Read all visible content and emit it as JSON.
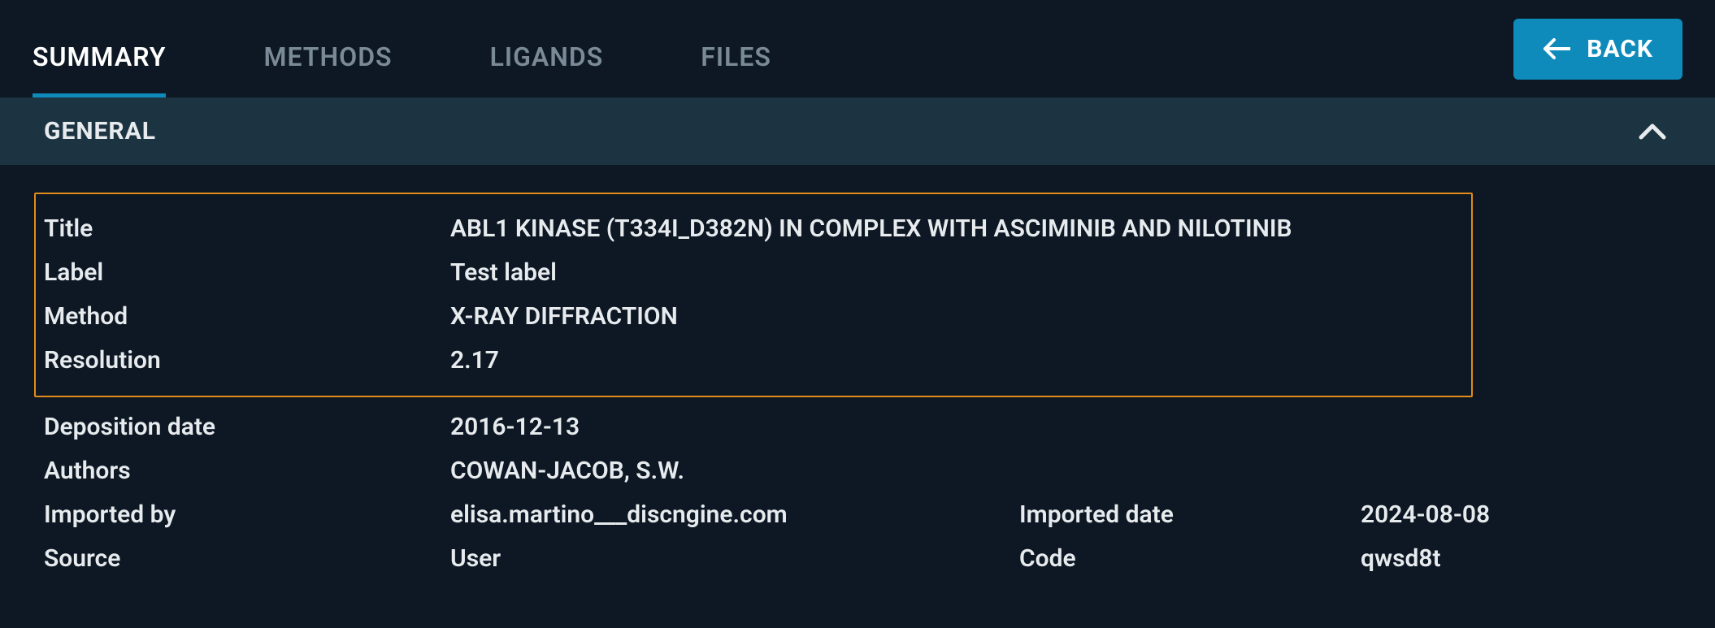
{
  "tabs": {
    "summary": "SUMMARY",
    "methods": "METHODS",
    "ligands": "LIGANDS",
    "files": "FILES"
  },
  "back_button": "BACK",
  "section_title": "GENERAL",
  "fields": {
    "title_label": "Title",
    "title_value": "ABL1 KINASE (T334I_D382N) IN COMPLEX WITH ASCIMINIB AND NILOTINIB",
    "label_label": "Label",
    "label_value": "Test label",
    "method_label": "Method",
    "method_value": "X-RAY DIFFRACTION",
    "resolution_label": "Resolution",
    "resolution_value": "2.17",
    "deposition_label": "Deposition date",
    "deposition_value": "2016-12-13",
    "authors_label": "Authors",
    "authors_value": "COWAN-JACOB, S.W.",
    "importedby_label": "Imported by",
    "importedby_value": "elisa.martino___discngine.com",
    "importeddate_label": "Imported date",
    "importeddate_value": "2024-08-08",
    "source_label": "Source",
    "source_value": "User",
    "code_label": "Code",
    "code_value": "qwsd8t"
  }
}
